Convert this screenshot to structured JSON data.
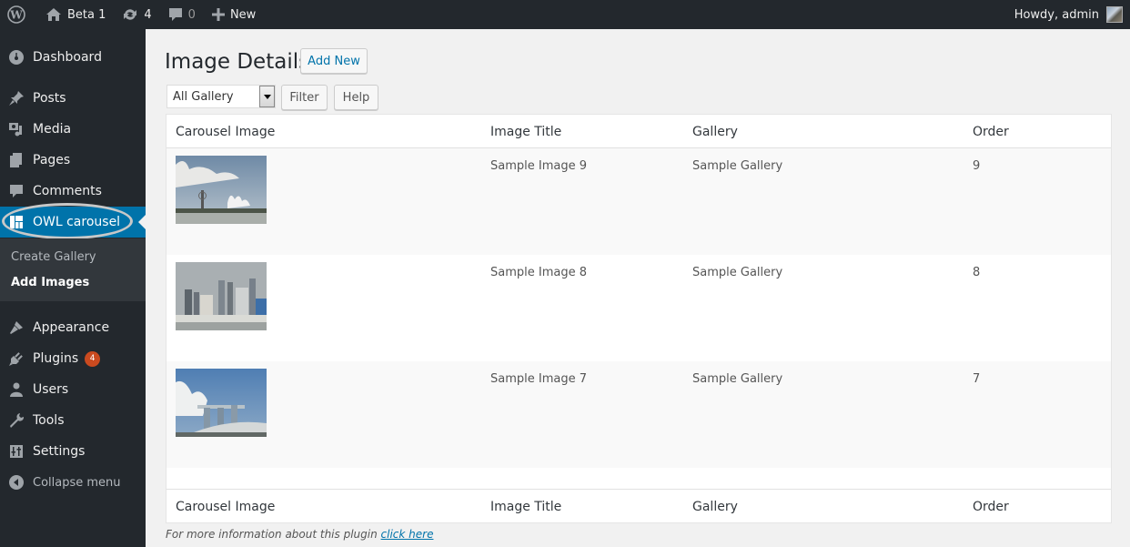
{
  "adminbar": {
    "site_name": "Beta 1",
    "updates_count": "4",
    "comments_count": "0",
    "new_label": "New",
    "greeting": "Howdy, admin"
  },
  "sidebar": {
    "items": [
      {
        "label": "Dashboard",
        "icon": "dashboard-icon"
      },
      {
        "label": "Posts",
        "icon": "pin-icon"
      },
      {
        "label": "Media",
        "icon": "media-icon"
      },
      {
        "label": "Pages",
        "icon": "pages-icon"
      },
      {
        "label": "Comments",
        "icon": "comment-icon"
      },
      {
        "label": "OWL carousel",
        "icon": "grid-icon",
        "active": true
      },
      {
        "label": "Appearance",
        "icon": "brush-icon"
      },
      {
        "label": "Plugins",
        "icon": "plug-icon",
        "badge": "4"
      },
      {
        "label": "Users",
        "icon": "user-icon"
      },
      {
        "label": "Tools",
        "icon": "wrench-icon"
      },
      {
        "label": "Settings",
        "icon": "sliders-icon"
      }
    ],
    "submenu": [
      {
        "label": "Create Gallery"
      },
      {
        "label": "Add Images",
        "current": true
      }
    ],
    "collapse_label": "Collapse menu"
  },
  "main": {
    "title": "Image Details",
    "add_new_label": "Add New",
    "filter_select": {
      "selected": "All Gallery"
    },
    "filter_label": "Filter",
    "help_label": "Help",
    "table": {
      "columns": [
        "Carousel Image",
        "Image Title",
        "Gallery",
        "Order"
      ],
      "rows": [
        {
          "image": "skyline-lotus-thumbnail",
          "title": "Sample Image 9",
          "gallery": "Sample Gallery",
          "order": "9"
        },
        {
          "image": "city-towers-thumbnail",
          "title": "Sample Image 8",
          "gallery": "Sample Gallery",
          "order": "8"
        },
        {
          "image": "marina-hotel-thumbnail",
          "title": "Sample Image 7",
          "gallery": "Sample Gallery",
          "order": "7"
        }
      ]
    },
    "footer_note": "For more information about this plugin",
    "footer_link": "click here"
  },
  "colors": {
    "adminbar_bg": "#23282d",
    "active_menu": "#0073aa",
    "badge": "#ca4a1f",
    "link": "#0073aa"
  }
}
